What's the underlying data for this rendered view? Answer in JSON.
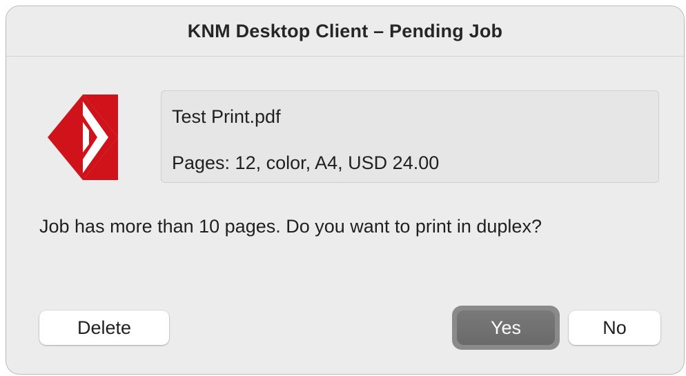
{
  "window": {
    "title": "KNM Desktop Client – Pending Job"
  },
  "logo": {
    "icon": "kyocera-logo-icon",
    "color": "#d0121b"
  },
  "job": {
    "file_name": "Test Print.pdf",
    "details": "Pages: 12, color, A4, USD 24.00"
  },
  "prompt": {
    "message": "Job has more than 10 pages. Do you want to print in duplex?"
  },
  "buttons": {
    "delete_label": "Delete",
    "yes_label": "Yes",
    "no_label": "No",
    "default": "Yes"
  }
}
